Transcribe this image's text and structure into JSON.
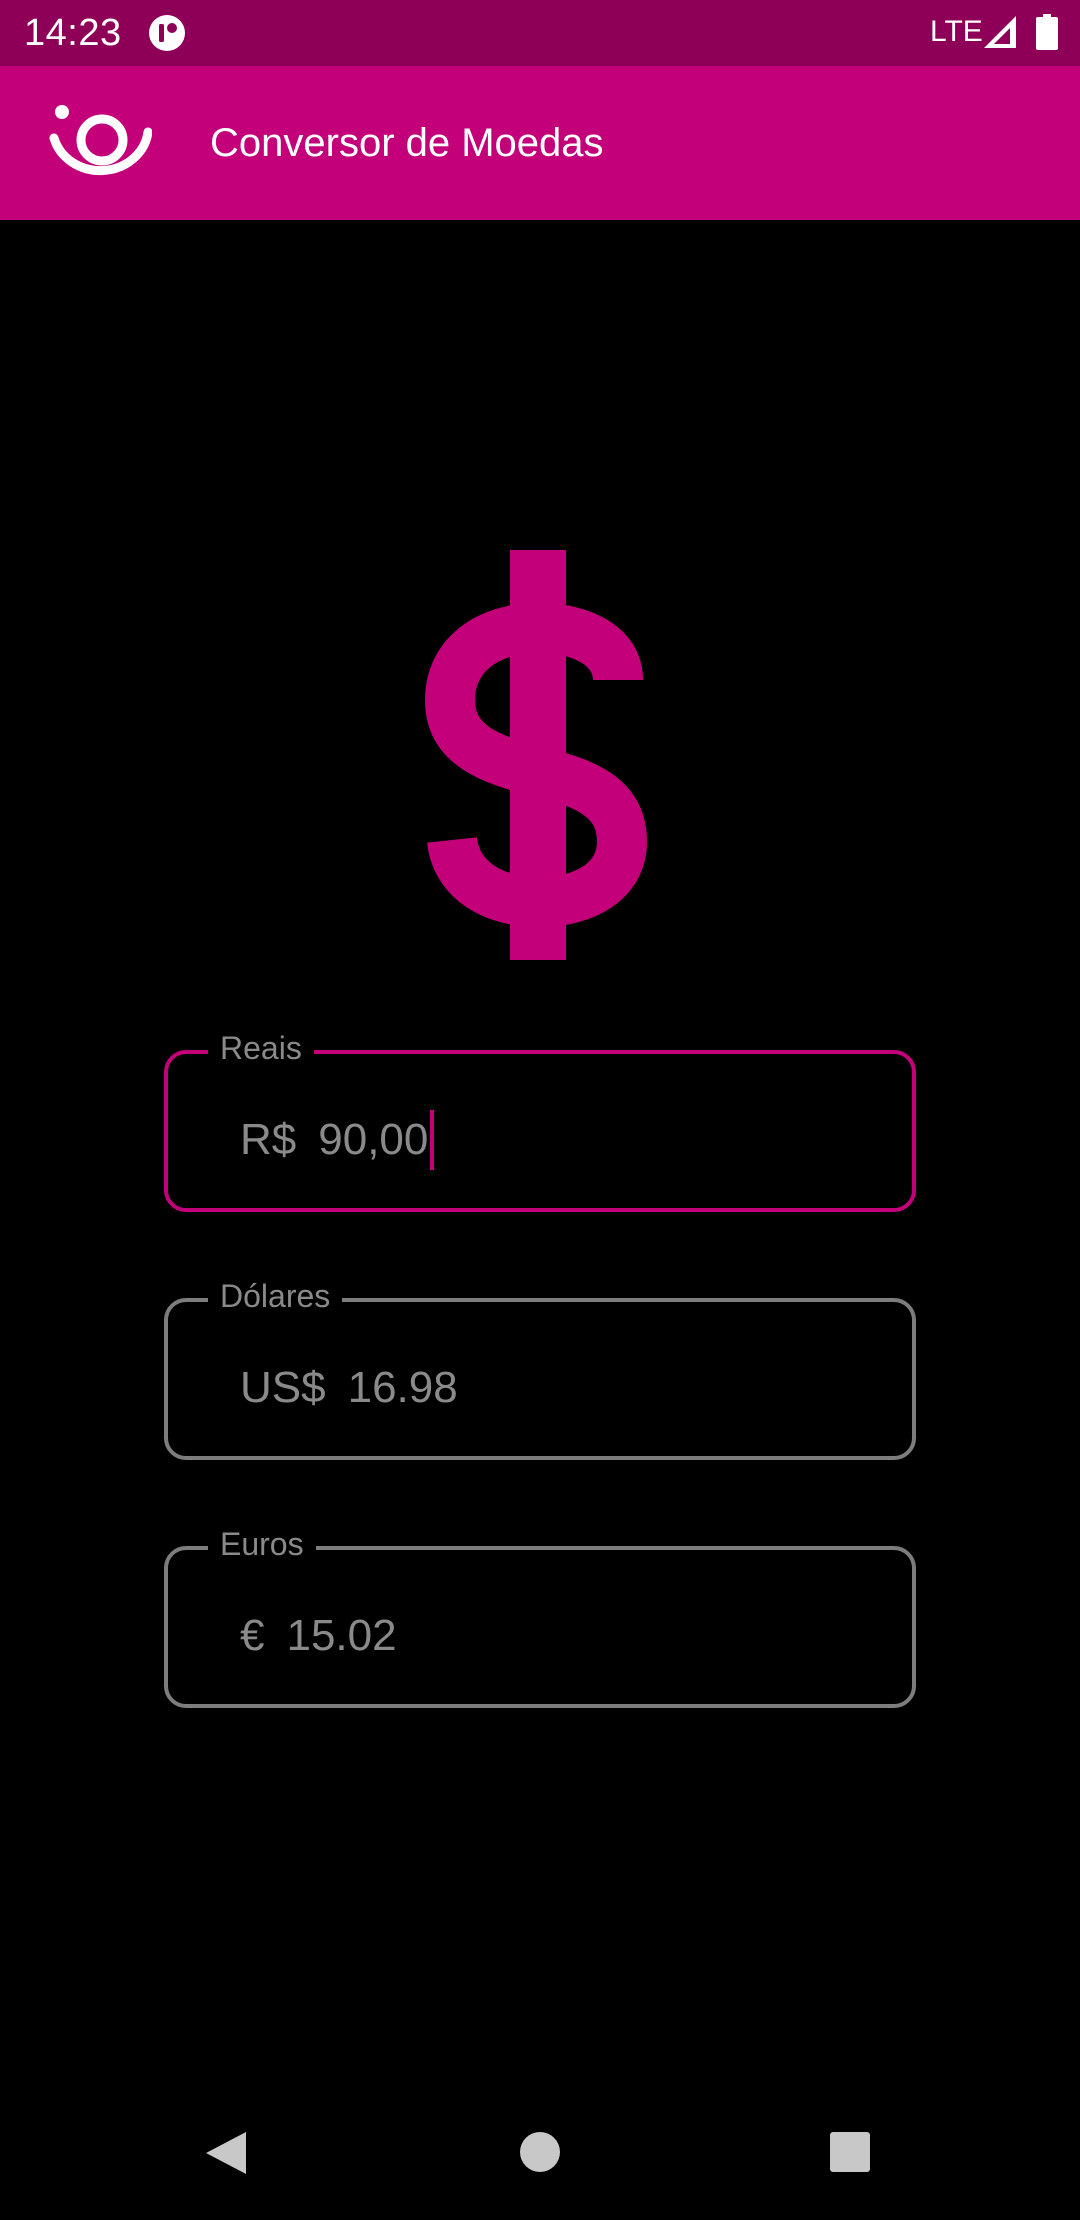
{
  "status_bar": {
    "time": "14:23",
    "network": "LTE",
    "app_icon": "notification-app-icon",
    "signal_icon": "cell-signal-icon",
    "battery_icon": "battery-icon"
  },
  "app_bar": {
    "title": "Conversor de Moedas",
    "logo_icon": "app-logo-icon",
    "background_color": "#c3007a"
  },
  "hero": {
    "icon": "dollar-sign-icon",
    "color": "#c3007a"
  },
  "fields": {
    "reais": {
      "label": "Reais",
      "prefix": "R$",
      "value": "90,00",
      "focused": true
    },
    "dolares": {
      "label": "Dólares",
      "prefix": "US$",
      "value": "16.98",
      "focused": false
    },
    "euros": {
      "label": "Euros",
      "prefix": "€",
      "value": "15.02",
      "focused": false
    }
  },
  "nav_bar": {
    "back_icon": "back-triangle-icon",
    "home_icon": "home-circle-icon",
    "recents_icon": "recents-square-icon"
  },
  "colors": {
    "accent": "#c3007a",
    "status_bar": "#8e0057",
    "background": "#000000",
    "inactive_border": "#7d7d7d",
    "text_muted": "#8a8a8a"
  }
}
